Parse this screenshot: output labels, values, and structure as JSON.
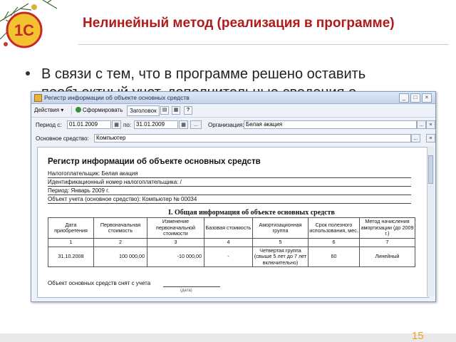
{
  "slide": {
    "title": "Нелинейный метод (реализация в программе)",
    "bullet_line1": "В связи с тем, что в программе решено оставить",
    "bullet_line2": "пообъектный учет, дополнительные сведения о",
    "page_number": "15",
    "logo_text": "1С"
  },
  "window": {
    "title": "Регистр информации об объекте основных средств",
    "toolbar": {
      "actions": "Действия",
      "generate": "Сформировать",
      "heading": "Заголовок"
    },
    "filters": {
      "period_label": "Период с:",
      "period_from": "01.01.2009",
      "to_label": "по:",
      "period_to": "31.01.2009",
      "org_label": "Организация:",
      "org_value": "Белая акация",
      "asset_label": "Основное средство:",
      "asset_value": "Компьютер"
    },
    "report": {
      "title": "Регистр информации об объекте основных средств",
      "info": [
        "Налогоплательщик: Белая акация",
        "Идентификационный номер налогоплательщика: /",
        "Период: Январь 2009 г.",
        "Объект учета (основное средство): Компьютер № 00034"
      ],
      "section_title": "I. Общая информация об объекте основных средств",
      "columns": [
        "Дата приобретения",
        "Первоначальная стоимость",
        "Изменение первоначальной стоимости",
        "Базовая стоимость",
        "Амортизационная группа",
        "Срок полезного использования, мес.",
        "Метод начисления амортизации (до 2009 г.)"
      ],
      "col_numbers": [
        "1",
        "2",
        "3",
        "4",
        "5",
        "6",
        "7"
      ],
      "row": [
        "31.10.2008",
        "100 000,00",
        "-10 000,00",
        "-",
        "Четвертая группа (свыше 5 лет до 7 лет включительно)",
        "60",
        "Линейный"
      ],
      "removed_label": "Объект основных средств снят с учета",
      "removed_sub": "(дата)"
    }
  },
  "colors": {
    "title_red": "#b01a1a",
    "page_number_orange": "#f0a020"
  }
}
